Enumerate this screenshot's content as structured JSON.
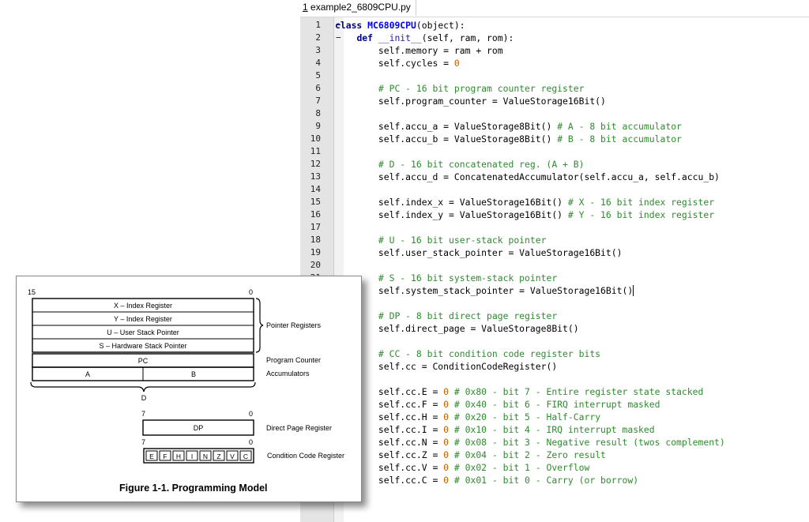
{
  "tab": {
    "number": "1",
    "filename": "example2_6809CPU.py"
  },
  "line_numbers": [
    "1",
    "2",
    "3",
    "4",
    "5",
    "6",
    "7",
    "8",
    "9",
    "10",
    "11",
    "12",
    "13",
    "14",
    "15",
    "16",
    "17",
    "18",
    "19",
    "20",
    "21"
  ],
  "fold_markers": [
    "−",
    "−"
  ],
  "code": {
    "l1_kw": "class",
    "l1_name": "MC6809CPU",
    "l1_rest": "(object):",
    "l2_kw": "def",
    "l2_name": "__init__",
    "l2_rest": "(self, ram, rom):",
    "l3": "self.memory = ram + rom",
    "l4_a": "self.cycles = ",
    "l4_num": "0",
    "l6": "# PC - 16 bit program counter register",
    "l7": "self.program_counter = ValueStorage16Bit()",
    "l9_a": "self.accu_a = ValueStorage8Bit() ",
    "l9_c": "# A - 8 bit accumulator",
    "l10_a": "self.accu_b = ValueStorage8Bit() ",
    "l10_c": "# B - 8 bit accumulator",
    "l12": "# D - 16 bit concatenated reg. (A + B)",
    "l13": "self.accu_d = ConcatenatedAccumulator(self.accu_a, self.accu_b)",
    "l15_a": "self.index_x = ValueStorage16Bit() ",
    "l15_c": "# X - 16 bit index register",
    "l16_a": "self.index_y = ValueStorage16Bit() ",
    "l16_c": "# Y - 16 bit index register",
    "l18": "# U - 16 bit user-stack pointer",
    "l19": "self.user_stack_pointer = ValueStorage16Bit()",
    "l21": "# S - 16 bit system-stack pointer",
    "l22": "self.system_stack_pointer = ValueStorage16Bit()",
    "l24": "# DP - 8 bit direct page register",
    "l25": "self.direct_page = ValueStorage8Bit()",
    "l27": "# CC - 8 bit condition code register bits",
    "l28": "self.cc = ConditionCodeRegister()",
    "flags": [
      {
        "a": "self.cc.E = ",
        "n": "0",
        "c": " # 0x80 - bit 7 - Entire register state stacked"
      },
      {
        "a": "self.cc.F = ",
        "n": "0",
        "c": " # 0x40 - bit 6 - FIRQ interrupt masked"
      },
      {
        "a": "self.cc.H = ",
        "n": "0",
        "c": " # 0x20 - bit 5 - Half-Carry"
      },
      {
        "a": "self.cc.I = ",
        "n": "0",
        "c": " # 0x10 - bit 4 - IRQ interrupt masked"
      },
      {
        "a": "self.cc.N = ",
        "n": "0",
        "c": " # 0x08 - bit 3 - Negative result (twos complement)"
      },
      {
        "a": "self.cc.Z = ",
        "n": "0",
        "c": " # 0x04 - bit 2 - Zero result"
      },
      {
        "a": "self.cc.V = ",
        "n": "0",
        "c": " # 0x02 - bit 1 - Overflow"
      },
      {
        "a": "self.cc.C = ",
        "n": "0",
        "c": " # 0x01 - bit 0 - Carry (or borrow)"
      }
    ]
  },
  "figure": {
    "bit15": "15",
    "bit0": "0",
    "registers": [
      "X – Index Register",
      "Y – Index Register",
      "U – User Stack Pointer",
      "S – Hardware Stack Pointer"
    ],
    "pointer_label": "Pointer Registers",
    "pc": "PC",
    "pc_label": "Program Counter",
    "acc_a": "A",
    "acc_b": "B",
    "acc_label": "Accumulators",
    "d_label": "D",
    "bit7": "7",
    "dp": "DP",
    "dp_label": "Direct Page Register",
    "cc_bits": [
      "E",
      "F",
      "H",
      "I",
      "N",
      "Z",
      "V",
      "C"
    ],
    "cc_label": "Condition Code Register",
    "caption": "Figure 1-1.  Programming Model"
  }
}
